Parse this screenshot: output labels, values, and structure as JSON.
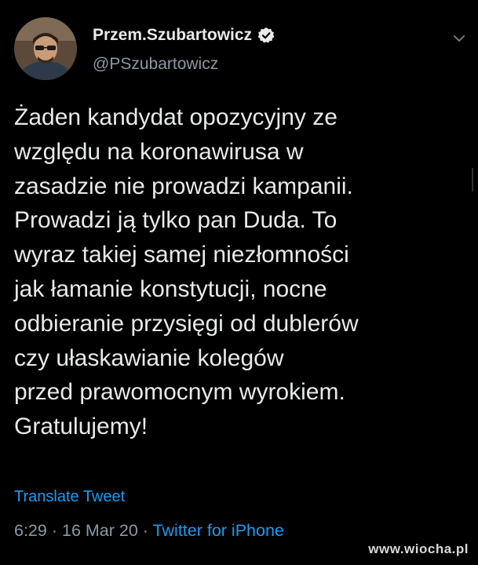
{
  "user": {
    "display_name": "Przem.Szubartowicz",
    "handle": "@PSzubartowicz",
    "verified": true,
    "avatar_icon": "avatar-photo"
  },
  "tweet": {
    "text": "Żaden kandydat opozycyjny ze\nwzględu na koronawirusa w\nzasadzie nie prowadzi kampanii.\nProwadzi ją tylko pan Duda. To\nwyraz takiej samej niezłomności\njak łamanie konstytucji, nocne\nodbieranie przysięgi od dublerów\nczy ułaskawianie kolegów\nprzed prawomocnym wyrokiem.\nGratulujemy!",
    "translate_label": "Translate Tweet",
    "time": "6:29",
    "separator": "·",
    "date": "16 Mar 20",
    "source": "Twitter for iPhone"
  },
  "watermark": "www.wiocha.pl",
  "colors": {
    "background": "#000000",
    "text": "#e7e9ea",
    "muted": "#8b98a5",
    "link": "#1d9bf0"
  },
  "icons": {
    "verified": "verified-badge-icon",
    "menu": "chevron-down-icon"
  }
}
